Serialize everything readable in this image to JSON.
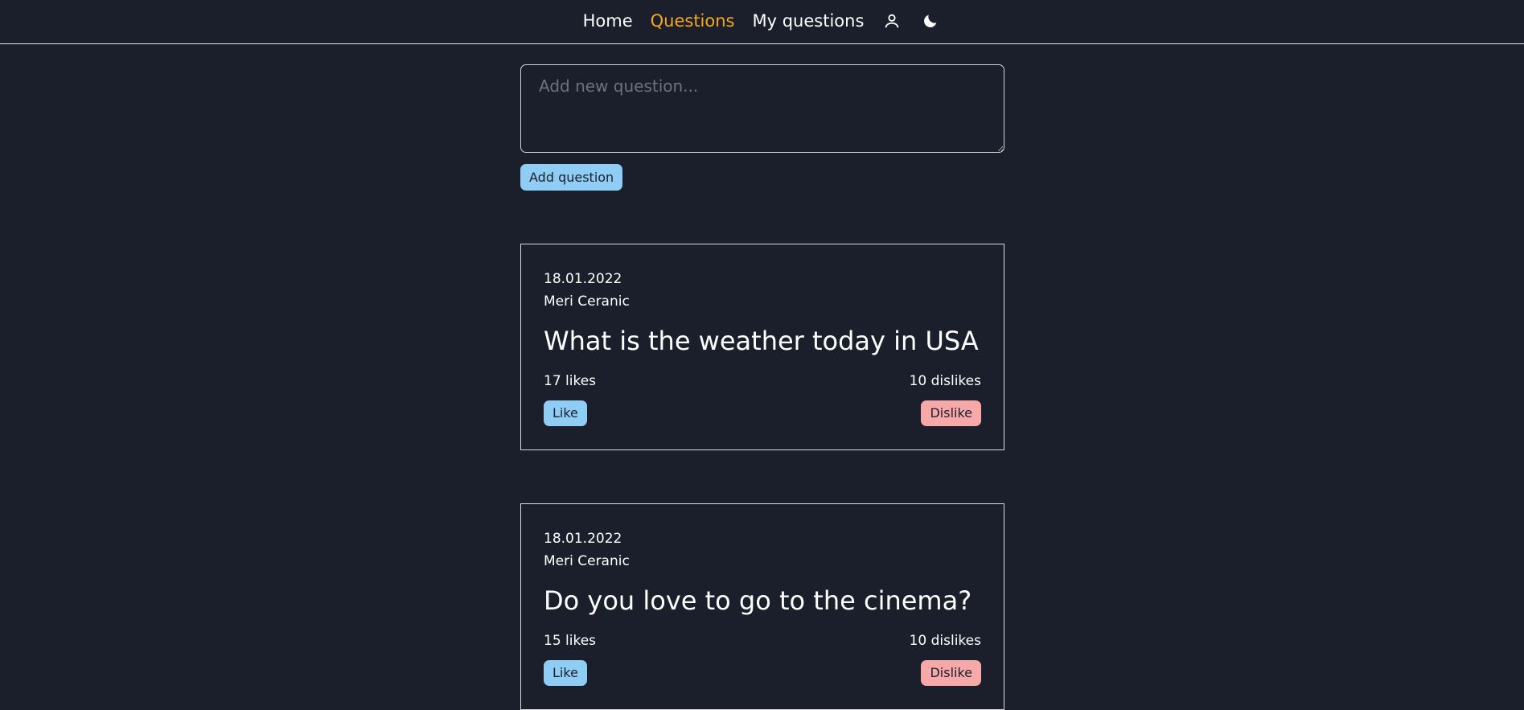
{
  "nav": {
    "home": "Home",
    "questions": "Questions",
    "my_questions": "My questions",
    "profile_icon": "user-icon",
    "theme_icon": "moon-icon",
    "active_color": "#f5a623"
  },
  "composer": {
    "placeholder": "Add new question...",
    "value": "",
    "add_label": "Add question"
  },
  "questions": [
    {
      "date": "18.01.2022",
      "author": "Meri Ceranic",
      "title": "What is the weather today in USA",
      "likes": "17 likes",
      "dislikes": "10 dislikes",
      "like_label": "Like",
      "dislike_label": "Dislike"
    },
    {
      "date": "18.01.2022",
      "author": "Meri Ceranic",
      "title": "Do you love to go to the cinema?",
      "likes": "15 likes",
      "dislikes": "10 dislikes",
      "like_label": "Like",
      "dislike_label": "Dislike"
    }
  ],
  "colors": {
    "background": "#1b1f2b",
    "like_button": "#8fcdf5",
    "dislike_button": "#f7a9aa"
  }
}
